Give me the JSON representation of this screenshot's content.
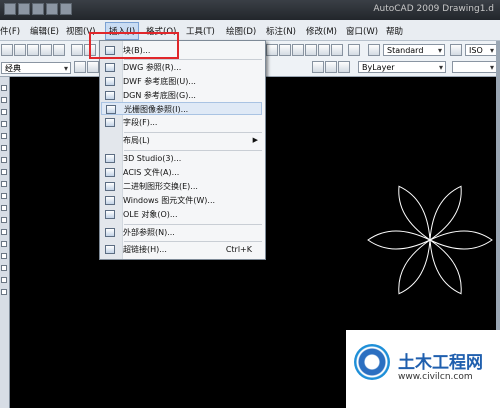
{
  "window": {
    "title": "AutoCAD 2009  Drawing1.d"
  },
  "menubar": {
    "items": [
      "件(F)",
      "编辑(E)",
      "视图(V)",
      "插入(I)",
      "格式(O)",
      "工具(T)",
      "绘图(D)",
      "标注(N)",
      "修改(M)",
      "窗口(W)",
      "帮助"
    ],
    "open_index": 3
  },
  "toolbar": {
    "textstyle": "Standard",
    "dimstyle": "ISO",
    "workspace": "经典",
    "layer_color": "ByLayer"
  },
  "insert_menu": {
    "items": [
      {
        "label": "块(B)...",
        "shortcut": "",
        "submenu": false,
        "highlight": false
      },
      {
        "label": "DWG 参照(R)...",
        "shortcut": "",
        "submenu": false,
        "highlight": false
      },
      {
        "label": "DWF 参考底图(U)...",
        "shortcut": "",
        "submenu": false,
        "highlight": false
      },
      {
        "label": "DGN 参考底图(G)...",
        "shortcut": "",
        "submenu": false,
        "highlight": false
      },
      {
        "label": "光栅图像参照(I)...",
        "shortcut": "",
        "submenu": false,
        "highlight": true
      },
      {
        "label": "字段(F)...",
        "shortcut": "",
        "submenu": false,
        "highlight": false
      },
      {
        "label": "布局(L)",
        "shortcut": "",
        "submenu": true,
        "highlight": false
      },
      {
        "label": "3D Studio(3)...",
        "shortcut": "",
        "submenu": false,
        "highlight": false
      },
      {
        "label": "ACIS 文件(A)...",
        "shortcut": "",
        "submenu": false,
        "highlight": false
      },
      {
        "label": "二进制图形交换(E)...",
        "shortcut": "",
        "submenu": false,
        "highlight": false
      },
      {
        "label": "Windows 图元文件(W)...",
        "shortcut": "",
        "submenu": false,
        "highlight": false
      },
      {
        "label": "OLE 对象(O)...",
        "shortcut": "",
        "submenu": false,
        "highlight": false
      },
      {
        "label": "外部参照(N)...",
        "shortcut": "",
        "submenu": false,
        "highlight": false
      },
      {
        "label": "超链接(H)...",
        "shortcut": "Ctrl+K",
        "submenu": false,
        "highlight": false
      }
    ]
  },
  "watermark": {
    "name": "土木工程网",
    "url": "www.civilcn.com"
  },
  "colors": {
    "highlight": "#e0262a",
    "canvas": "#000000",
    "menu_bg": "#f5f6f8"
  }
}
